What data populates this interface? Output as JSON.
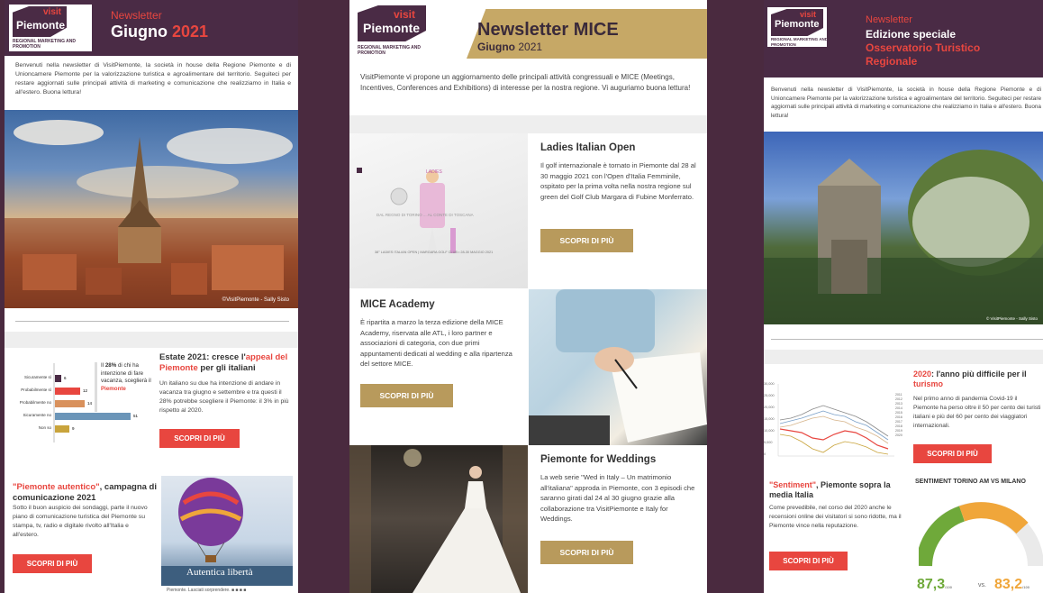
{
  "panel1": {
    "header_top": "Newsletter",
    "header_month": "Giugno",
    "header_year": "2021",
    "logo_visit": "visit",
    "logo_main": "Piemonte",
    "logo_sub": "REGIONAL MARKETING AND PROMOTION",
    "intro": "Benvenuti nella newsletter di VisitPiemonte, la società in house della Regione Piemonte e di Unioncamere Piemonte per la valorizzazione turistica e agroalimentare del territorio. Seguiteci per restare aggiornati sulle principali attività di marketing e comunicazione che realizziamo in Italia e all'estero. Buona lettura!",
    "photo_credit": "©VisitPiemonte - Sally Sisto",
    "article1_title_a": "Estate 2021: cresce l'",
    "article1_title_red": "appeal del Piemonte",
    "article1_title_b": " per gli italiani",
    "article1_body": "Un italiano su due ha intenzione di andare in vacanza tra giugno e settembre e tra questi il 28% potrebbe scegliere il Piemonte: il 3% in più rispetto al 2020.",
    "article1_button": "SCOPRI DI PIÙ",
    "chart_note_a": "Il ",
    "chart_note_b": "28%",
    "chart_note_c": " di chi ha intenzione di fare vacanza, sceglierà il ",
    "chart_note_red": "Piemonte",
    "chart_labels": [
      "Sicuramente sì",
      "Probabilmente sì",
      "Probabilmente no",
      "Sicuramente no",
      "Non so"
    ],
    "chart_values": [
      "6",
      "12",
      "14",
      "51",
      "9"
    ],
    "article2_title_red": "\"Piemonte autentico\"",
    "article2_title_b": ", campagna di comunicazione 2021",
    "article2_body": "Sotto il buon auspicio dei sondaggi, parte il nuovo piano di comunicazione turistica del Piemonte su stampa, tv, radio e digitale rivolto all'Italia e all'estero.",
    "article2_button": "SCOPRI DI PIÙ",
    "balloon_caption": "Autentica libertà",
    "balloon_sub": "Piemonte. Lasciati sorprendere. ■ ■ ■ ■"
  },
  "panel2": {
    "header_title": "Newsletter MICE",
    "header_month": "Giugno",
    "header_year": "2021",
    "logo_visit": "visit",
    "logo_main": "Piemonte",
    "logo_sub": "REGIONAL MARKETING AND PROMOTION",
    "intro": "VisitPiemonte vi propone un aggiornamento delle principali attività congressuali e MICE (Meetings, Incentives, Conferences and Exhibitions) di interesse per la nostra regione. Vi auguriamo buona lettura!",
    "golf_title": "Ladies Italian Open",
    "golf_body": "Il golf internazionale è tornato in Piemonte dal 28 al 30 maggio 2021 con l'Open d'Italia Femminile, ospitato per la prima volta nella nostra regione sul green del Golf Club Margara di Fubine Monferrato.",
    "golf_button": "SCOPRI DI PIÙ",
    "golf_banner": "38° LADIES ITALIAN OPEN | MARGARA GOLF CLUB • 28-30 MAGGIO 2021",
    "golf_ladies": "LADIES",
    "golf_tagline": "DAL REGNO DI TORINO ... AL CONTE DI TOSCANA",
    "academy_title": "MICE Academy",
    "academy_body": "È ripartita a marzo la terza edizione della MICE Academy, riservata alle ATL, i loro partner e associazioni di categoria, con due primi appuntamenti dedicati al wedding e alla ripartenza del settore MICE.",
    "academy_button": "SCOPRI DI PIÙ",
    "wedding_title": "Piemonte for Weddings",
    "wedding_body": "La web serie \"Wed in Italy – Un matrimonio all'italiana\" approda in Piemonte, con 3 episodi che saranno girati dal 24 al 30 giugno grazie alla collaborazione tra VisitPiemonte e Italy for Weddings.",
    "wedding_button": "SCOPRI DI PIÙ"
  },
  "panel3": {
    "header_top": "Newsletter",
    "header_line2": "Edizione speciale",
    "header_line3": "Osservatorio Turistico",
    "header_line4": "Regionale",
    "logo_visit": "visit",
    "logo_main": "Piemonte",
    "logo_sub": "REGIONAL MARKETING AND PROMOTION",
    "intro": "Benvenuti nella newsletter di VisitPiemonte, la società in house della Regione Piemonte e di Unioncamere Piemonte per la valorizzazione turistica e agroalimentare del territorio. Seguiteci per restare aggiornati sulle principali attività di marketing e comunicazione che realizziamo in Italia e all'estero. Buona lettura!",
    "photo_credit": "© VisitPiemonte - Sally Sisto",
    "article1_title_red": "2020",
    "article1_title_b": ": l'anno più difficile per il ",
    "article1_title_red2": "turismo",
    "article1_body": "Nel primo anno di pandemia Covid-19 il Piemonte ha perso oltre il 50 per cento dei turisti italiani e più del 60 per cento dei viaggiatori internazionali.",
    "article1_button": "SCOPRI DI PIÙ",
    "linechart_y": [
      "30,000",
      "25,000",
      "20,000",
      "15,000",
      "10,000",
      "5,000",
      "0"
    ],
    "legend": [
      "2011",
      "2012",
      "2013",
      "2014",
      "2015",
      "2016",
      "2017",
      "2018",
      "2019",
      "2020"
    ],
    "article2_title_red": "\"Sentiment\"",
    "article2_title_b": ", Piemonte sopra la media Italia",
    "article2_body": "Come prevedibile, nel corso del 2020 anche le recensioni online dei visitatori si sono ridotte, ma il Piemonte vince nella reputazione.",
    "article2_button": "SCOPRI DI PIÙ",
    "gauge_title": "SENTIMENT TORINO AM VS MILANO",
    "gauge_left": "87,3",
    "gauge_left_unit": "/100",
    "gauge_vs": "vs.",
    "gauge_right": "83,2",
    "gauge_right_unit": "/100"
  }
}
